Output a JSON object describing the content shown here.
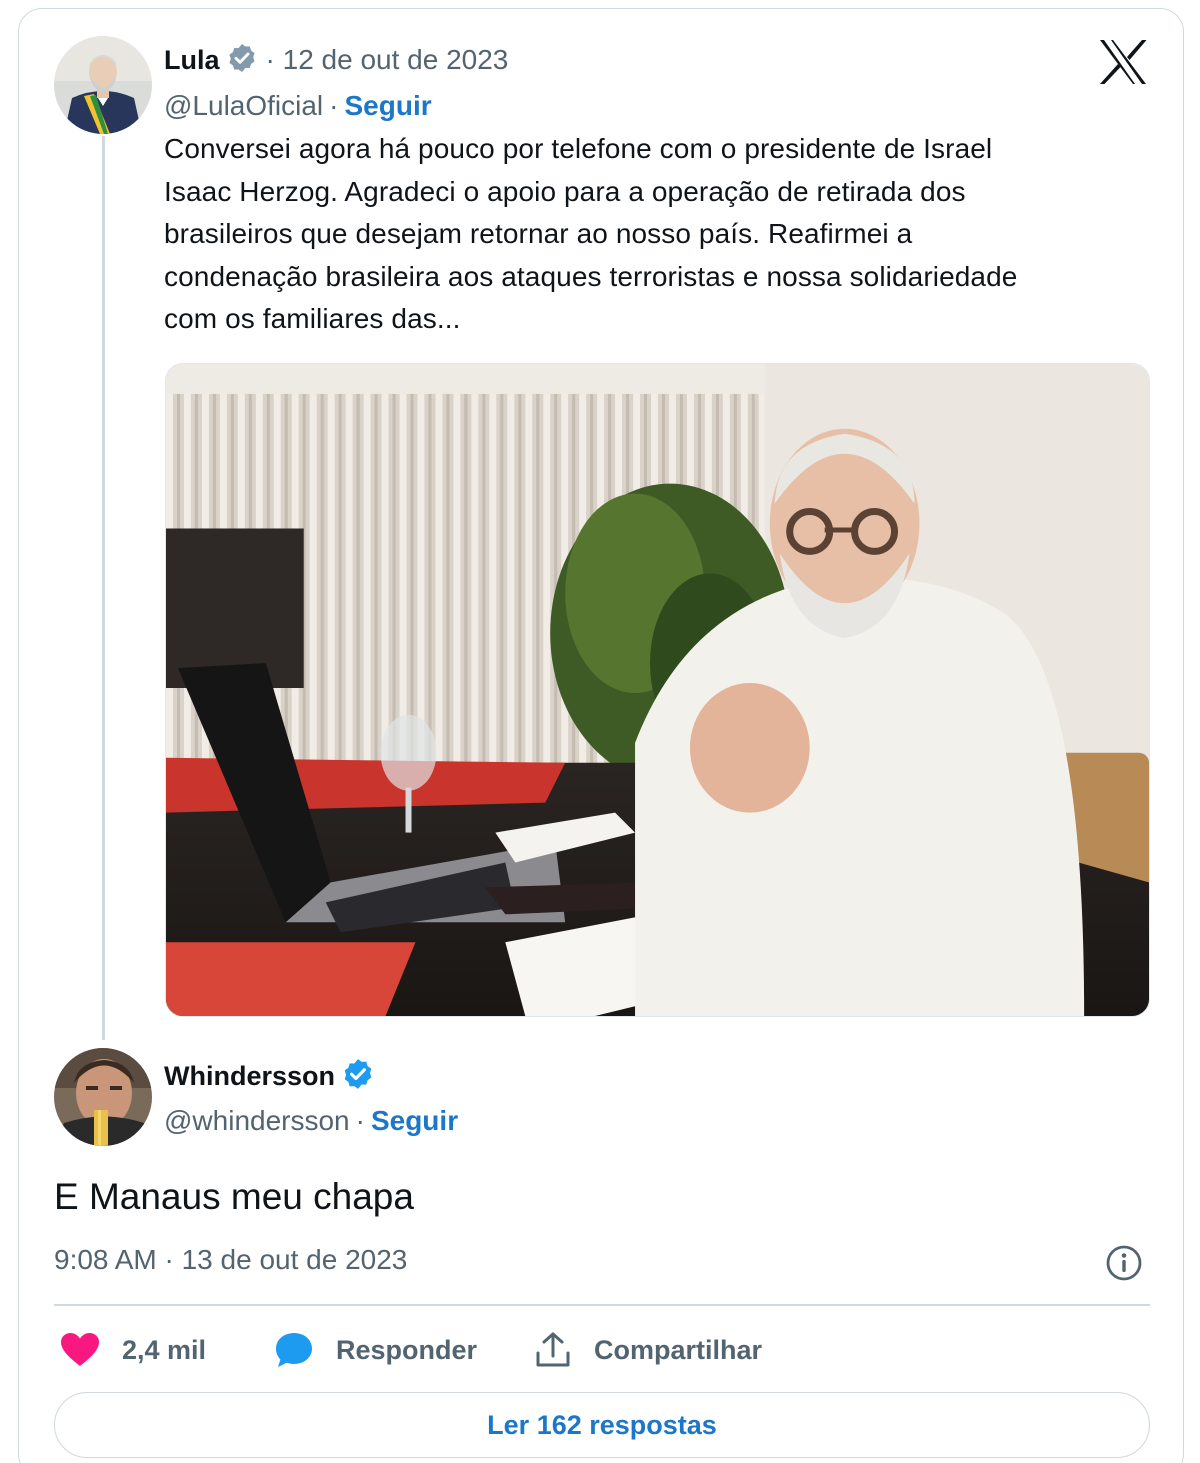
{
  "quoted_tweet": {
    "author_name": "Lula",
    "date": "· 12 de out de 2023",
    "handle": "@LulaOficial",
    "separator": "·",
    "follow_label": "Seguir",
    "text_lines": [
      "Conversei agora há pouco por telefone com o presidente de Israel",
      "Isaac Herzog. Agradeci o apoio para a operação de retirada dos",
      "brasileiros que desejam retornar ao nosso país. Reafirmei a",
      "condenação brasileira aos ataques terroristas e nossa solidariedade",
      "com os familiares das..."
    ],
    "badge_color": "#829aab"
  },
  "main_tweet": {
    "author_name": "Whindersson",
    "handle": "@whindersson",
    "separator": "·",
    "follow_label": "Seguir",
    "text": "E Manaus meu chapa",
    "timestamp": "9:08 AM · 13 de out de 2023",
    "badge_color": "#1d9bf0"
  },
  "actions": {
    "likes": "2,4 mil",
    "reply_label": "Responder",
    "share_label": "Compartilhar",
    "read_replies_label": "Ler 162 respostas"
  },
  "icons": {
    "platform_logo": "x-logo-icon",
    "like": "heart-icon",
    "reply": "speech-bubble-icon",
    "share": "share-upload-icon",
    "info": "info-icon",
    "verified": "verified-badge-icon"
  },
  "colors": {
    "like": "#f91880",
    "reply": "#1d9bf0",
    "link": "#1d77c8",
    "muted": "#536471",
    "border": "#cfd9de"
  }
}
